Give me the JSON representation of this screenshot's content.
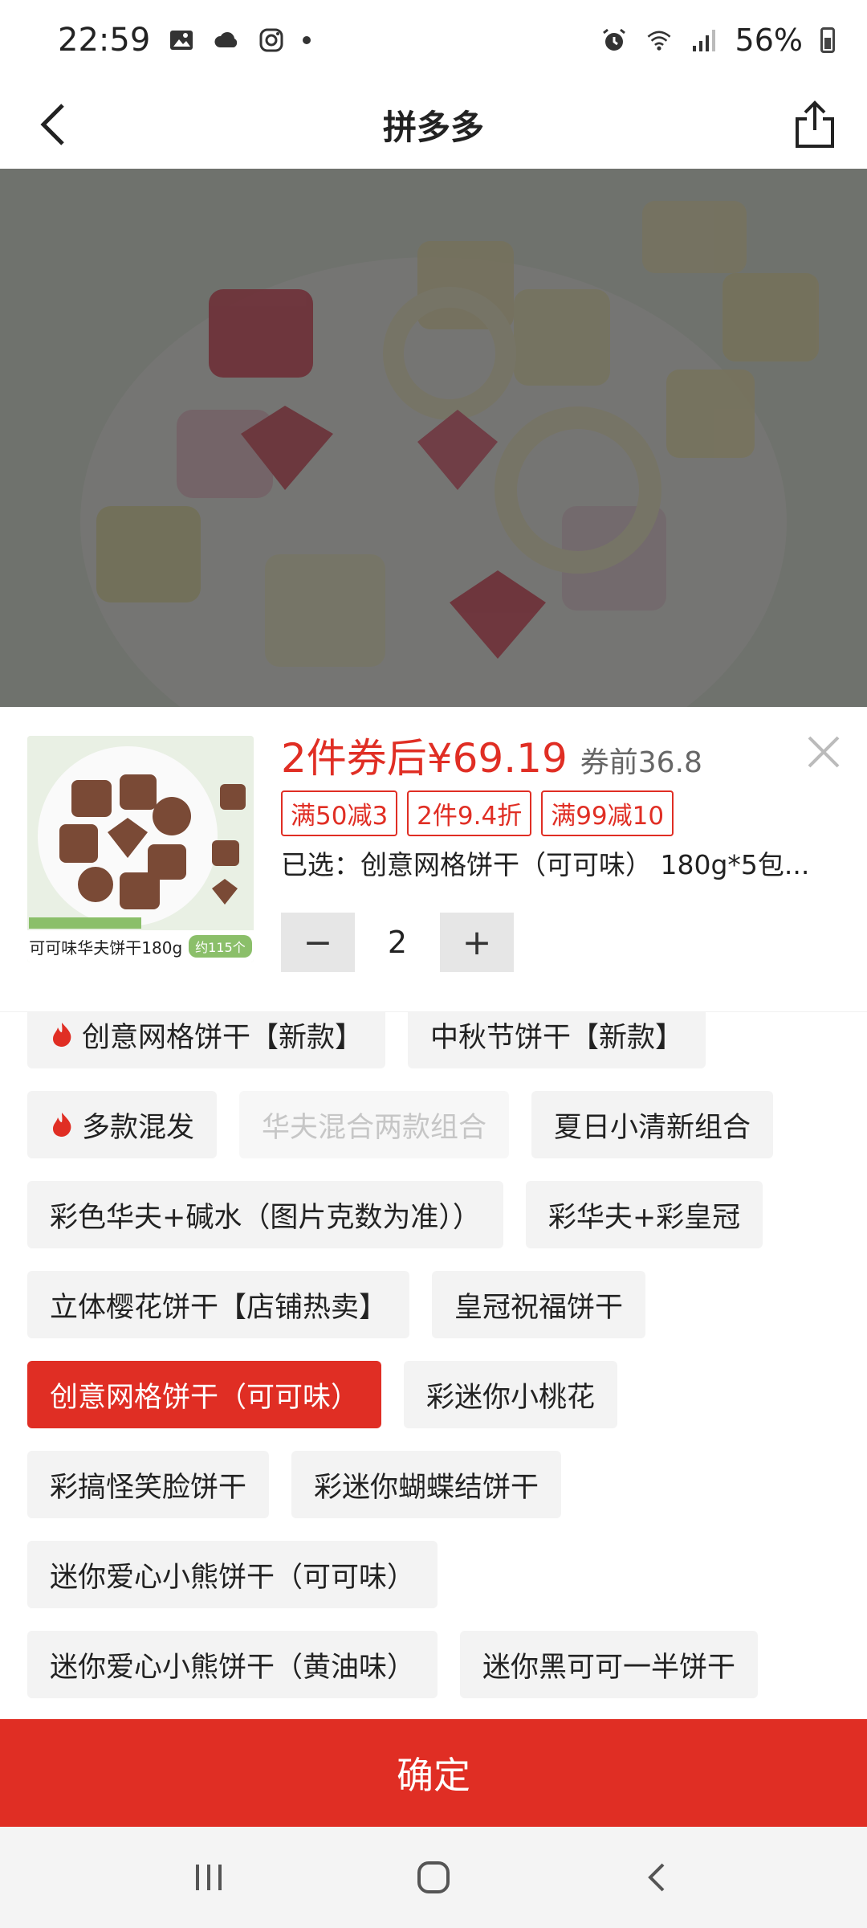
{
  "status_bar": {
    "time": "22:59",
    "battery_percent": "56%",
    "icons": [
      "gallery-icon",
      "cloud-icon",
      "instagram-icon",
      "dot-icon",
      "alarm-icon",
      "wifi-icon",
      "signal-icon",
      "battery-icon"
    ]
  },
  "header": {
    "title": "拼多多",
    "back_icon": "chevron-left-icon",
    "share_icon": "share-icon"
  },
  "product": {
    "thumbnail_caption": "可可味华夫饼干180g",
    "thumbnail_badge": "约115个",
    "price_label": "2件券后¥69.19",
    "price_before": "券前36.8",
    "coupons": [
      "满50减3",
      "2件9.4折",
      "满99减10"
    ],
    "selected": "已选：创意网格饼干（可可味） 180g*5包...",
    "quantity": "2",
    "minus_label": "−",
    "plus_label": "+"
  },
  "options": [
    {
      "label": "创意网格饼干【新款】",
      "hot": true,
      "state": "normal"
    },
    {
      "label": "中秋节饼干【新款】",
      "hot": false,
      "state": "normal"
    },
    {
      "label": "多款混发",
      "hot": true,
      "state": "normal"
    },
    {
      "label": "华夫混合两款组合",
      "hot": false,
      "state": "disabled"
    },
    {
      "label": "夏日小清新组合",
      "hot": false,
      "state": "normal"
    },
    {
      "label": "彩色华夫+碱水（图片克数为准））",
      "hot": false,
      "state": "normal"
    },
    {
      "label": "彩华夫+彩皇冠",
      "hot": false,
      "state": "normal"
    },
    {
      "label": "立体樱花饼干【店铺热卖】",
      "hot": false,
      "state": "normal"
    },
    {
      "label": "皇冠祝福饼干",
      "hot": false,
      "state": "normal"
    },
    {
      "label": "创意网格饼干（可可味）",
      "hot": false,
      "state": "selected"
    },
    {
      "label": "彩迷你小桃花",
      "hot": false,
      "state": "normal"
    },
    {
      "label": "彩搞怪笑脸饼干",
      "hot": false,
      "state": "normal"
    },
    {
      "label": "彩迷你蝴蝶结饼干",
      "hot": false,
      "state": "normal"
    },
    {
      "label": "迷你爱心小熊饼干（可可味）",
      "hot": false,
      "state": "normal"
    },
    {
      "label": "迷你爱心小熊饼干（黄油味）",
      "hot": false,
      "state": "normal"
    },
    {
      "label": "迷你黑可可一半饼干",
      "hot": false,
      "state": "normal"
    }
  ],
  "confirm_label": "确定",
  "colors": {
    "accent": "#e02e24",
    "chip_bg": "#f3f3f3",
    "overlay": "rgba(0,0,0,0.52)"
  }
}
